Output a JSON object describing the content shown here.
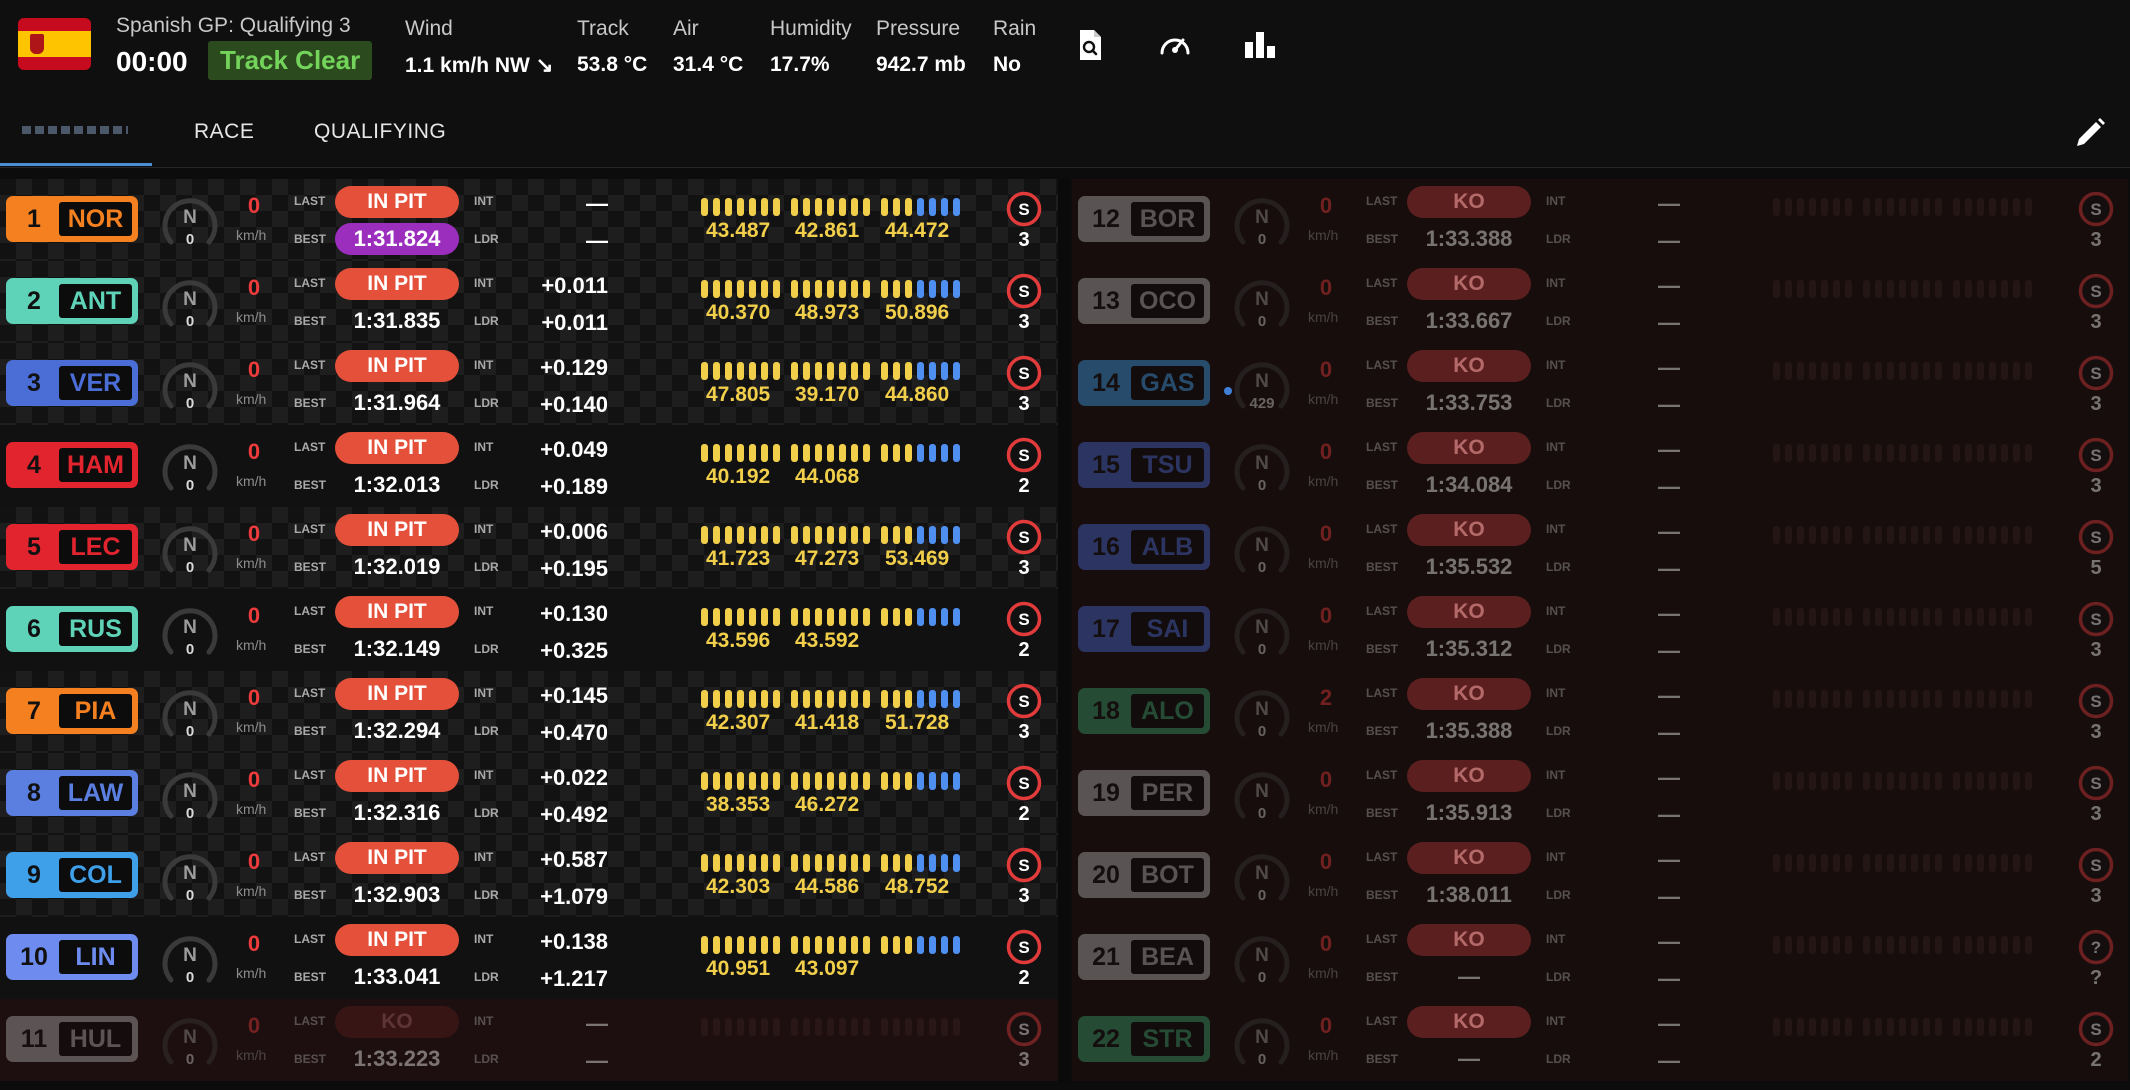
{
  "header": {
    "session": "Spanish GP: Qualifying 3",
    "clock": "00:00",
    "track_status": "Track Clear",
    "weather": [
      {
        "label": "Wind",
        "value": "1.1 km/h NW ↘"
      },
      {
        "label": "Track",
        "value": "53.8 °C"
      },
      {
        "label": "Air",
        "value": "31.4 °C"
      },
      {
        "label": "Humidity",
        "value": "17.7%"
      },
      {
        "label": "Pressure",
        "value": "942.7 mb"
      },
      {
        "label": "Rain",
        "value": "No"
      }
    ],
    "icons": [
      "document-search-icon",
      "speedometer-icon",
      "bar-chart-icon"
    ]
  },
  "tabs": {
    "race": "RACE",
    "qualifying": "QUALIFYING"
  },
  "labels": {
    "last": "LAST",
    "best": "BEST",
    "int": "INT",
    "ldr": "LDR",
    "kmh": "km/h",
    "gear": "N"
  },
  "colors": {
    "in_pit": "#e4503a",
    "purple": "#9b2ebd",
    "sector_yellow": "#f2cf4a",
    "segment_blue": "#4f8ff0",
    "track_clear": "#74d35b"
  },
  "drivers_left": [
    {
      "pos": "1",
      "code": "NOR",
      "team_color": "#f58020",
      "rpm": "0",
      "speed": "0",
      "status": "IN PIT",
      "best": "1:31.824",
      "best_purple": true,
      "int": "—",
      "ldr": "—",
      "sectors": [
        "43.487",
        "42.861",
        "44.472"
      ],
      "sector_count": 3,
      "tyre": "S",
      "laps": "3",
      "bg": "chk"
    },
    {
      "pos": "2",
      "code": "ANT",
      "team_color": "#5ed3b8",
      "rpm": "0",
      "speed": "0",
      "status": "IN PIT",
      "best": "1:31.835",
      "best_purple": false,
      "int": "+0.011",
      "ldr": "+0.011",
      "sectors": [
        "40.370",
        "48.973",
        "50.896"
      ],
      "sector_count": 3,
      "tyre": "S",
      "laps": "3",
      "bg": "chk"
    },
    {
      "pos": "3",
      "code": "VER",
      "team_color": "#4a6ed6",
      "rpm": "0",
      "speed": "0",
      "status": "IN PIT",
      "best": "1:31.964",
      "best_purple": false,
      "int": "+0.129",
      "ldr": "+0.140",
      "sectors": [
        "47.805",
        "39.170",
        "44.860"
      ],
      "sector_count": 3,
      "tyre": "S",
      "laps": "3",
      "bg": "chk"
    },
    {
      "pos": "4",
      "code": "HAM",
      "team_color": "#e2242f",
      "rpm": "0",
      "speed": "0",
      "status": "IN PIT",
      "best": "1:32.013",
      "best_purple": false,
      "int": "+0.049",
      "ldr": "+0.189",
      "sectors": [
        "40.192",
        "44.068"
      ],
      "sector_count": 3,
      "tyre": "S",
      "laps": "2",
      "bg": "plain"
    },
    {
      "pos": "5",
      "code": "LEC",
      "team_color": "#e2242f",
      "rpm": "0",
      "speed": "0",
      "status": "IN PIT",
      "best": "1:32.019",
      "best_purple": false,
      "int": "+0.006",
      "ldr": "+0.195",
      "sectors": [
        "41.723",
        "47.273",
        "53.469"
      ],
      "sector_count": 3,
      "tyre": "S",
      "laps": "3",
      "bg": "chk"
    },
    {
      "pos": "6",
      "code": "RUS",
      "team_color": "#5ed3b8",
      "rpm": "0",
      "speed": "0",
      "status": "IN PIT",
      "best": "1:32.149",
      "best_purple": false,
      "int": "+0.130",
      "ldr": "+0.325",
      "sectors": [
        "43.596",
        "43.592"
      ],
      "sector_count": 3,
      "tyre": "S",
      "laps": "2",
      "bg": "plain"
    },
    {
      "pos": "7",
      "code": "PIA",
      "team_color": "#f58020",
      "rpm": "0",
      "speed": "0",
      "status": "IN PIT",
      "best": "1:32.294",
      "best_purple": false,
      "int": "+0.145",
      "ldr": "+0.470",
      "sectors": [
        "42.307",
        "41.418",
        "51.728"
      ],
      "sector_count": 3,
      "tyre": "S",
      "laps": "3",
      "bg": "chk"
    },
    {
      "pos": "8",
      "code": "LAW",
      "team_color": "#5a7fe0",
      "rpm": "0",
      "speed": "0",
      "status": "IN PIT",
      "best": "1:32.316",
      "best_purple": false,
      "int": "+0.022",
      "ldr": "+0.492",
      "sectors": [
        "38.353",
        "46.272"
      ],
      "sector_count": 3,
      "tyre": "S",
      "laps": "2",
      "bg": "chk"
    },
    {
      "pos": "9",
      "code": "COL",
      "team_color": "#3fa0ea",
      "rpm": "0",
      "speed": "0",
      "status": "IN PIT",
      "best": "1:32.903",
      "best_purple": false,
      "int": "+0.587",
      "ldr": "+1.079",
      "sectors": [
        "42.303",
        "44.586",
        "48.752"
      ],
      "sector_count": 3,
      "tyre": "S",
      "laps": "3",
      "bg": "chk"
    },
    {
      "pos": "10",
      "code": "LIN",
      "team_color": "#6e8cf0",
      "rpm": "0",
      "speed": "0",
      "status": "IN PIT",
      "best": "1:33.041",
      "best_purple": false,
      "int": "+0.138",
      "ldr": "+1.217",
      "sectors": [
        "40.951",
        "43.097"
      ],
      "sector_count": 3,
      "tyre": "S",
      "laps": "2",
      "bg": "plain"
    },
    {
      "pos": "11",
      "code": "HUL",
      "team_color": "#b4b4b4",
      "rpm": "0",
      "speed": "0",
      "status": "KO",
      "best": "1:33.223",
      "best_purple": false,
      "int": "—",
      "ldr": "—",
      "sectors": [],
      "sector_count": 0,
      "tyre": "S",
      "laps": "3",
      "bg": "ko",
      "dim": true
    }
  ],
  "drivers_right": [
    {
      "pos": "12",
      "code": "BOR",
      "team_color": "#b4b4b4",
      "rpm": "0",
      "speed": "0",
      "status": "KO",
      "best": "1:33.388",
      "int": "—",
      "ldr": "—",
      "tyre": "S",
      "laps": "3"
    },
    {
      "pos": "13",
      "code": "OCO",
      "team_color": "#b4b4b4",
      "rpm": "0",
      "speed": "0",
      "status": "KO",
      "best": "1:33.667",
      "int": "—",
      "ldr": "—",
      "tyre": "S",
      "laps": "3"
    },
    {
      "pos": "14",
      "code": "GAS",
      "team_color": "#3fa0ea",
      "rpm": "429",
      "speed": "0",
      "status": "KO",
      "best": "1:33.753",
      "int": "—",
      "ldr": "—",
      "tyre": "S",
      "laps": "3"
    },
    {
      "pos": "15",
      "code": "TSU",
      "team_color": "#4a6ed6",
      "rpm": "0",
      "speed": "0",
      "status": "KO",
      "best": "1:34.084",
      "int": "—",
      "ldr": "—",
      "tyre": "S",
      "laps": "3"
    },
    {
      "pos": "16",
      "code": "ALB",
      "team_color": "#4a6ed6",
      "rpm": "0",
      "speed": "0",
      "status": "KO",
      "best": "1:35.532",
      "int": "—",
      "ldr": "—",
      "tyre": "S",
      "laps": "5"
    },
    {
      "pos": "17",
      "code": "SAI",
      "team_color": "#4a6ed6",
      "rpm": "0",
      "speed": "0",
      "status": "KO",
      "best": "1:35.312",
      "int": "—",
      "ldr": "—",
      "tyre": "S",
      "laps": "3"
    },
    {
      "pos": "18",
      "code": "ALO",
      "team_color": "#3aa06a",
      "rpm": "0",
      "speed": "2",
      "status": "KO",
      "best": "1:35.388",
      "int": "—",
      "ldr": "—",
      "tyre": "S",
      "laps": "3"
    },
    {
      "pos": "19",
      "code": "PER",
      "team_color": "#b4b4b4",
      "rpm": "0",
      "speed": "0",
      "status": "KO",
      "best": "1:35.913",
      "int": "—",
      "ldr": "—",
      "tyre": "S",
      "laps": "3"
    },
    {
      "pos": "20",
      "code": "BOT",
      "team_color": "#b4b4b4",
      "rpm": "0",
      "speed": "0",
      "status": "KO",
      "best": "1:38.011",
      "int": "—",
      "ldr": "—",
      "tyre": "S",
      "laps": "3"
    },
    {
      "pos": "21",
      "code": "BEA",
      "team_color": "#b4b4b4",
      "rpm": "0",
      "speed": "0",
      "status": "KO",
      "best": "—",
      "int": "—",
      "ldr": "—",
      "tyre": "?",
      "laps": "?"
    },
    {
      "pos": "22",
      "code": "STR",
      "team_color": "#3aa06a",
      "rpm": "0",
      "speed": "0",
      "status": "KO",
      "best": "—",
      "int": "—",
      "ldr": "—",
      "tyre": "S",
      "laps": "2"
    }
  ]
}
